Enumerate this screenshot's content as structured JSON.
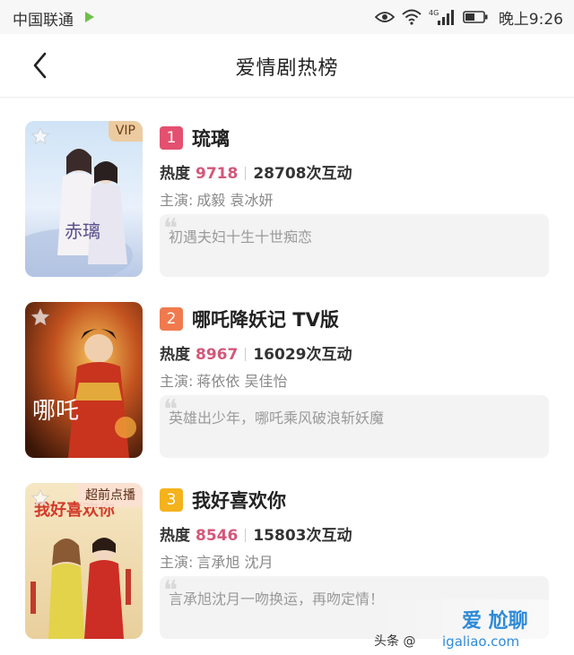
{
  "status_bar": {
    "carrier": "中国联通",
    "network": "4G",
    "time": "晚上9:26"
  },
  "nav": {
    "title": "爱情剧热榜"
  },
  "labels": {
    "heat": "热度",
    "cast": "主演:",
    "interactions_suffix": "次互动"
  },
  "items": [
    {
      "rank": "1",
      "rank_color": "#e4506f",
      "title": "琉璃",
      "heat": "9718",
      "interactions": "28708次互动",
      "actors": "成毅 袁冰妍",
      "quote": "初遇夫妇十生十世痴恋",
      "poster_badge": "VIP",
      "poster_art": "赤璃"
    },
    {
      "rank": "2",
      "rank_color": "#f07a4e",
      "title": "哪吒降妖记 TV版",
      "heat": "8967",
      "interactions": "16029次互动",
      "actors": "蒋依依 吴佳怡",
      "quote": "英雄出少年，哪吒乘风破浪斩妖魔",
      "poster_badge": "",
      "poster_art": "哪吒"
    },
    {
      "rank": "3",
      "rank_color": "#f4b21c",
      "title": "我好喜欢你",
      "heat": "8546",
      "interactions": "15803次互动",
      "actors": "言承旭 沈月",
      "quote": "言承旭沈月一吻换运，再吻定情！",
      "poster_badge": "超前点播",
      "poster_art": "我好喜欢你"
    }
  ],
  "watermark": {
    "source": "头条 @",
    "site": "爱 尬聊",
    "domain": "igaliao.com"
  }
}
